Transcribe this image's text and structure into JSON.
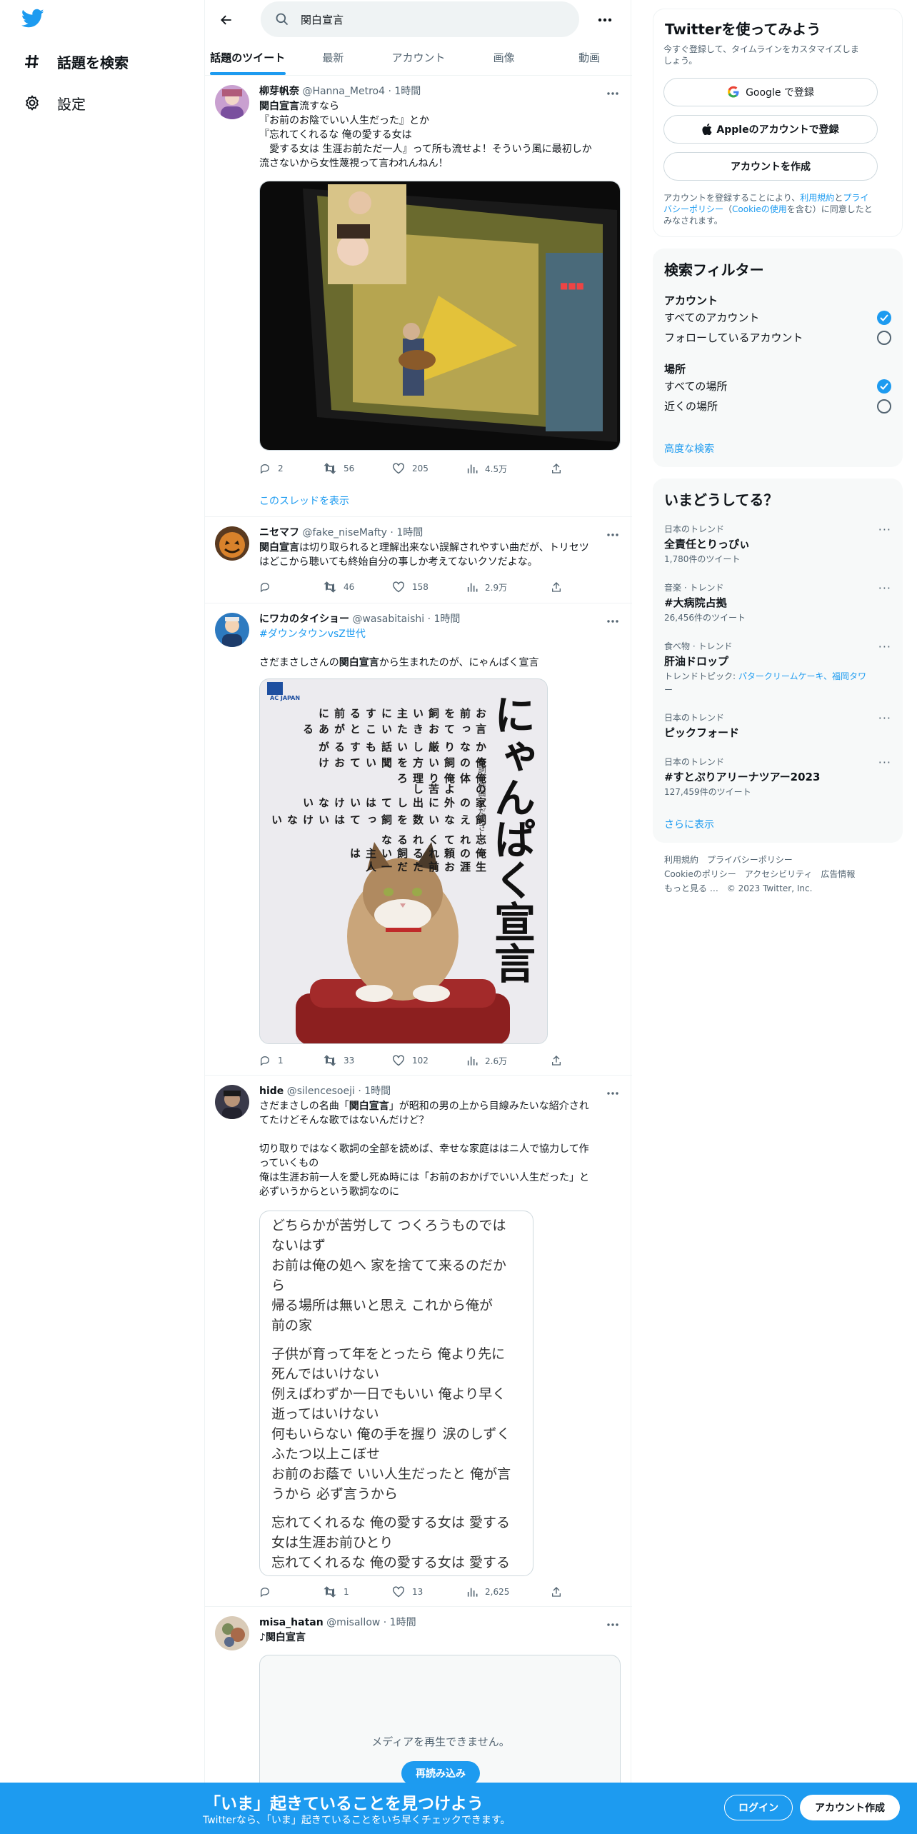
{
  "nav": {
    "explore_label": "話題を検索",
    "settings_label": "設定"
  },
  "search": {
    "query": "関白宣言"
  },
  "tabs": [
    "話題のツイート",
    "最新",
    "アカウント",
    "画像",
    "動画"
  ],
  "tweets": [
    {
      "name": "柳芽帆奈",
      "handle": "@Hanna_Metro4 · 1時間",
      "lines": [
        "流すなら",
        "『お前のお陰でいい人生だった』とか",
        "『忘れてくれるな 俺の愛する女は",
        "　愛する女は 生涯お前ただ一人』って所も流せよ！そういう風に最初しか",
        "流さないから女性蔑視って言われんねん！"
      ],
      "bold_lead": "関白宣言",
      "replies": "2",
      "retweets": "56",
      "likes": "205",
      "views": "4.5万",
      "show_thread": "このスレッドを表示"
    },
    {
      "name": "ニセマフ",
      "handle": "@fake_niseMafty · 1時間",
      "bold_lead": "関白宣言",
      "line1": "は切り取られると理解出来ない誤解されやすい曲だが、トリセツ",
      "line2": "はどこから聴いても終始自分の事しか考えてないクソだよな。",
      "replies": "",
      "retweets": "46",
      "likes": "158",
      "views": "2.9万"
    },
    {
      "name": "にワカのタイショー",
      "handle": "@wasabitaishi · 1時間",
      "hashtag": "#ダウンタウンvsZ世代",
      "text_pre": "さだまさしさんの",
      "bold": "関白宣言",
      "text_post": "から生まれたのが、にゃんぱく宣言",
      "replies": "1",
      "retweets": "33",
      "likes": "102",
      "views": "2.6万"
    },
    {
      "name": "hide",
      "handle": "@silencesoeji · 1時間",
      "l1_pre": "さだまさしの名曲「",
      "l1_bold": "関白宣言",
      "l1_post": "」が昭和の男の上から目線みたいな紹介され",
      "l2": "てたけどそんな歌ではないんだけど？",
      "l3": "切り取りではなく歌詞の全部を読めば、幸せな家庭ははニ人で協力して作",
      "l4": "っていくもの",
      "l5": "俺は生涯お前一人を愛し死ぬ時には「お前のおかげでいい人生だった」と",
      "l6": "必ずいうからという歌詞なのに",
      "replies": "",
      "retweets": "1",
      "likes": "13",
      "views": "2,625"
    },
    {
      "name": "misa_hatan",
      "handle": "@misallow · 1時間",
      "text_pre": "♪",
      "bold": "関白宣言",
      "media_error": "メディアを再生できません。",
      "reload": "再読み込み"
    }
  ],
  "nyanpaku": {
    "title": "にゃんぱく宣言",
    "credit": "作詞・作曲 さだまさし",
    "columns": [
      "お前を飼い主にする前に",
      "言っておきたいことがある",
      "かなり厳しい話もするが",
      "俺の飼い方を聞いておけ",
      "俺の体　俺より苦理しろ",
      "家の外に出してはいけない",
      "飼えない数を飼ってはいけない",
      "忘れてくれるな",
      "俺の頼れる飼い主は",
      "生涯 お前ただ一人"
    ],
    "org": "AC JAPAN"
  },
  "lyrics": [
    [
      "どちらかが苦労して つくろうものでは",
      "ないはず",
      "お前は俺の処へ 家を捨てて来るのだか",
      "ら",
      "帰る場所は無いと思え これから俺が",
      "前の家"
    ],
    [
      "子供が育って年をとったら 俺より先に",
      "死んではいけない",
      "例えばわずか一日でもいい 俺より早く",
      "逝ってはいけない",
      "何もいらない 俺の手を握り 涙のしずく",
      "ふたつ以上こぼせ",
      "お前のお蔭で いい人生だったと 俺が言",
      "うから 必ず言うから"
    ],
    [
      "忘れてくれるな 俺の愛する女は 愛する",
      "女は生涯お前ひとり",
      "忘れてくれるな 俺の愛する女は 愛する"
    ]
  ],
  "right": {
    "signup_title": "Twitterを使ってみよう",
    "signup_sub1": "今すぐ登録して、タイムラインをカスタマイズしま",
    "signup_sub2": "しょう。",
    "google_btn": "Google で登録",
    "apple_btn": "Appleのアカウントで登録",
    "create_btn": "アカウントを作成",
    "terms1_pre": "アカウントを登録することにより、",
    "terms1_link": "利用規約",
    "terms1_mid": "と",
    "terms1_link2": "プライ",
    "terms2_link": "バシーポリシー",
    "terms2_mid": "（",
    "terms2_link2": "Cookieの使用",
    "terms2_post": "を含む）に同意したと",
    "terms3": "みなされます。",
    "filter_title": "検索フィルター",
    "filter_account": "アカウント",
    "filter_all_accounts": "すべてのアカウント",
    "filter_following": "フォローしているアカウント",
    "filter_place": "場所",
    "filter_all_places": "すべての場所",
    "filter_near": "近くの場所",
    "advanced": "高度な検索",
    "trends_title": "いまどうしてる？",
    "trends": [
      {
        "cat": "日本のトレンド",
        "title": "全責任とりっぴぃ",
        "count": "1,780件のツイート"
      },
      {
        "cat": "音楽 · トレンド",
        "title": "#大病院占拠",
        "count": "26,456件のツイート"
      },
      {
        "cat": "食べ物 · トレンド",
        "title": "肝油ドロップ",
        "topic_pre": "トレンドトピック: ",
        "topic_links": "パタークリームケーキ、福岡タワ",
        "topic2": "ー"
      },
      {
        "cat": "日本のトレンド",
        "title": "ピックフォード"
      },
      {
        "cat": "日本のトレンド",
        "title": "#すとぷりアリーナツアー2023",
        "count": "127,459件のツイート"
      }
    ],
    "show_more": "さらに表示",
    "footer1": "利用規約　プライバシーポリシー",
    "footer2": "Cookieのポリシー　アクセシビリティ　広告情報",
    "footer3": "もっと見る …　© 2023 Twitter, Inc."
  },
  "bottom": {
    "title": "「いま」起きていることを見つけよう",
    "sub": "Twitterなら、「いま」起きていることをいち早くチェックできます。",
    "login": "ログイン",
    "signup": "アカウント作成"
  },
  "colors": {
    "accent": "#1d9bf0",
    "text": "#0f1419",
    "muted": "#536471",
    "border": "#eff3f4",
    "panel": "#f7f9f9"
  }
}
